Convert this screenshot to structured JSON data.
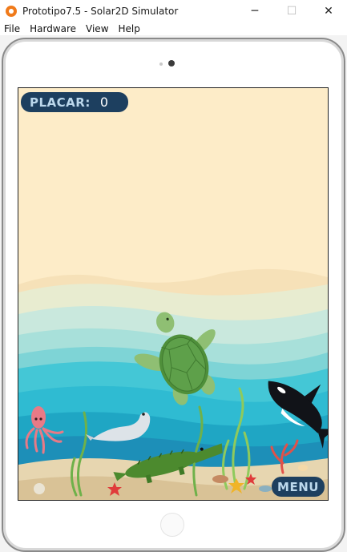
{
  "window": {
    "title": "Prototipo7.5 - Solar2D Simulator",
    "icon": "solar2d-icon"
  },
  "controls": {
    "minimize": "─",
    "maximize": "☐",
    "close": "✕"
  },
  "menubar": [
    "File",
    "Hardware",
    "View",
    "Help"
  ],
  "game": {
    "score_label": "PLACAR:",
    "score_value": "0",
    "menu_label": "MENU"
  },
  "colors": {
    "sky": "#fdecc8",
    "water_light": "#a8e0da",
    "water_mid": "#33c3d3",
    "water_deep": "#1fa6c4",
    "hud": "#1d3f5f",
    "hud_text": "#bcd8ec"
  }
}
